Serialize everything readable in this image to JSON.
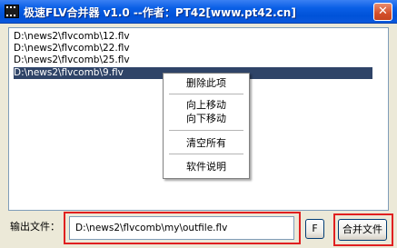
{
  "window": {
    "title": "极速FLV合并器 v1.0 --作者：PT42[www.pt42.cn]",
    "close_glyph": "✕",
    "icon": "film-icon"
  },
  "file_list": {
    "items": [
      {
        "text": "D:\\news2\\flvcomb\\12.flv",
        "selected": false
      },
      {
        "text": "D:\\news2\\flvcomb\\22.flv",
        "selected": false
      },
      {
        "text": "D:\\news2\\flvcomb\\25.flv",
        "selected": false
      },
      {
        "text": "D:\\news2\\flvcomb\\9.flv",
        "selected": true
      }
    ]
  },
  "context_menu": {
    "delete_item": "删除此项",
    "move_up": "向上移动",
    "move_down": "向下移动",
    "clear_all": "清空所有",
    "help": "软件说明"
  },
  "output": {
    "label": "输出文件：",
    "value": "D:\\news2\\flvcomb\\my\\outfile.flv"
  },
  "buttons": {
    "browse": "F",
    "merge": "合并文件"
  },
  "colors": {
    "selection": "#2f4468",
    "highlight_frame": "#e02020",
    "titlebar": "#0a5fe6"
  }
}
